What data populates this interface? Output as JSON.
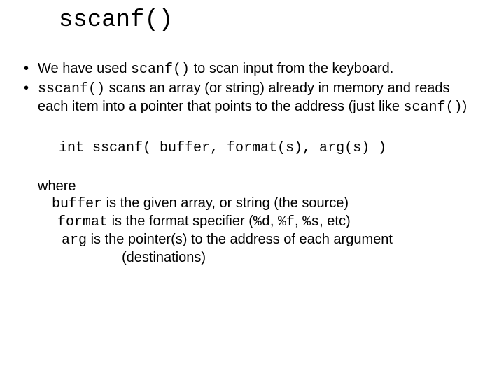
{
  "title": "sscanf()",
  "bullets": {
    "b1_pre": "We have used ",
    "b1_code": "scanf()",
    "b1_post": " to scan input from the keyboard.",
    "b2_code": "sscanf()",
    "b2_mid": " scans an array (or string) already in memory and reads each item into a pointer that points to the address (just like ",
    "b2_code2": "scanf()",
    "b2_post": ")"
  },
  "signature": "int sscanf( buffer, format(s), arg(s) )",
  "where": {
    "label": "where",
    "line2_code": "buffer",
    "line2_text": " is the given array, or string (the source)",
    "line3_code": "format",
    "line3_text": " is the format specifier (",
    "line3_c1": "%d",
    "line3_s1": ", ",
    "line3_c2": "%f",
    "line3_s2": ", ",
    "line3_c3": "%s",
    "line3_post": ", etc)",
    "line4_code": "arg",
    "line4_text": " is the pointer(s) to the address of each argument",
    "line5_text": "(destinations)"
  }
}
